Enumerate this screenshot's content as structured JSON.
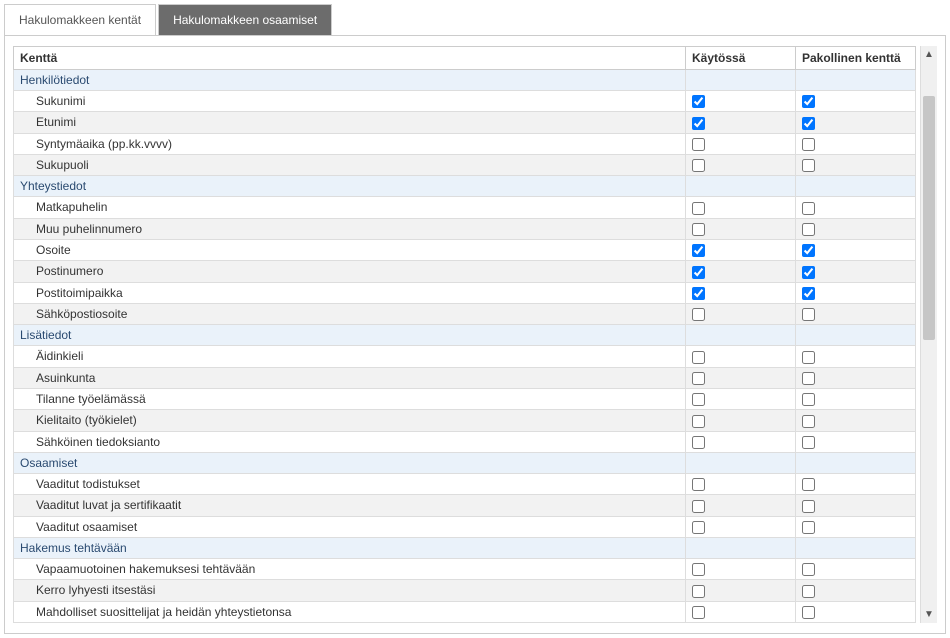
{
  "tabs": {
    "fields": "Hakulomakkeen kentät",
    "competences": "Hakulomakkeen osaamiset"
  },
  "columns": {
    "field": "Kenttä",
    "in_use": "Käytössä",
    "mandatory": "Pakollinen kenttä"
  },
  "rows": [
    {
      "type": "section",
      "label": "Henkilötiedot"
    },
    {
      "type": "item",
      "label": "Sukunimi",
      "in_use": true,
      "mandatory": true
    },
    {
      "type": "item",
      "label": "Etunimi",
      "in_use": true,
      "mandatory": true,
      "alt": true
    },
    {
      "type": "item",
      "label": "Syntymäaika (pp.kk.vvvv)",
      "in_use": false,
      "mandatory": false
    },
    {
      "type": "item",
      "label": "Sukupuoli",
      "in_use": false,
      "mandatory": false,
      "alt": true
    },
    {
      "type": "section",
      "label": "Yhteystiedot"
    },
    {
      "type": "item",
      "label": "Matkapuhelin",
      "in_use": false,
      "mandatory": false
    },
    {
      "type": "item",
      "label": "Muu puhelinnumero",
      "in_use": false,
      "mandatory": false,
      "alt": true
    },
    {
      "type": "item",
      "label": "Osoite",
      "in_use": true,
      "mandatory": true
    },
    {
      "type": "item",
      "label": "Postinumero",
      "in_use": true,
      "mandatory": true,
      "alt": true
    },
    {
      "type": "item",
      "label": "Postitoimipaikka",
      "in_use": true,
      "mandatory": true
    },
    {
      "type": "item",
      "label": "Sähköpostiosoite",
      "in_use": false,
      "mandatory": false,
      "alt": true
    },
    {
      "type": "section",
      "label": "Lisätiedot"
    },
    {
      "type": "item",
      "label": "Äidinkieli",
      "in_use": false,
      "mandatory": false
    },
    {
      "type": "item",
      "label": "Asuinkunta",
      "in_use": false,
      "mandatory": false,
      "alt": true
    },
    {
      "type": "item",
      "label": "Tilanne työelämässä",
      "in_use": false,
      "mandatory": false
    },
    {
      "type": "item",
      "label": "Kielitaito (työkielet)",
      "in_use": false,
      "mandatory": false,
      "alt": true
    },
    {
      "type": "item",
      "label": "Sähköinen tiedoksianto",
      "in_use": false,
      "mandatory": false
    },
    {
      "type": "section",
      "label": "Osaamiset"
    },
    {
      "type": "item",
      "label": "Vaaditut todistukset",
      "in_use": false,
      "mandatory": false
    },
    {
      "type": "item",
      "label": "Vaaditut luvat ja sertifikaatit",
      "in_use": false,
      "mandatory": false,
      "alt": true
    },
    {
      "type": "item",
      "label": "Vaaditut osaamiset",
      "in_use": false,
      "mandatory": false
    },
    {
      "type": "section",
      "label": "Hakemus tehtävään"
    },
    {
      "type": "item",
      "label": "Vapaamuotoinen hakemuksesi tehtävään",
      "in_use": false,
      "mandatory": false
    },
    {
      "type": "item",
      "label": "Kerro lyhyesti itsestäsi",
      "in_use": false,
      "mandatory": false,
      "alt": true
    },
    {
      "type": "item",
      "label": "Mahdolliset suosittelijat ja heidän yhteystietonsa",
      "in_use": false,
      "mandatory": false
    }
  ]
}
